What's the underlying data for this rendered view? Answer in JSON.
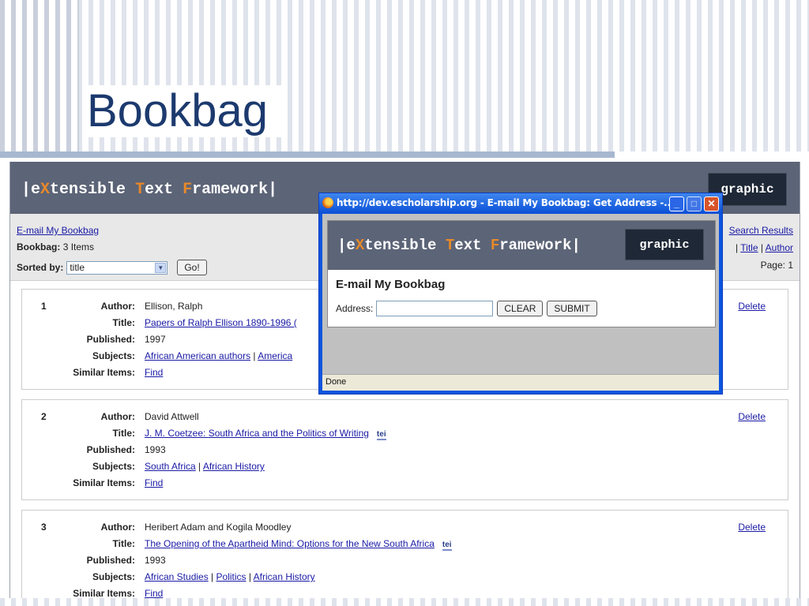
{
  "slide": {
    "title": "Bookbag"
  },
  "xtf": {
    "logo_parts": [
      "|e",
      "X",
      "tensible ",
      "T",
      "ext ",
      "F",
      "ramework|"
    ],
    "graphic_label": "graphic"
  },
  "toolbar": {
    "email_link": "E-mail My Bookbag",
    "bookbag_label": "Bookbag:",
    "bookbag_count": "3 Items",
    "sorted_by_label": "Sorted by:",
    "sort_value": "title",
    "go_label": "Go!",
    "search_results": "Search Results",
    "sort_sep": "|",
    "sort_title": "Title",
    "sort_author": "Author",
    "page_label": "Page: 1"
  },
  "labels": {
    "author": "Author:",
    "title": "Title:",
    "published": "Published:",
    "subjects": "Subjects:",
    "similar": "Similar Items:",
    "delete": "Delete",
    "find": "Find",
    "tei": "tei"
  },
  "items": [
    {
      "num": "1",
      "author": "Ellison, Ralph",
      "title": "Papers of Ralph Ellison 1890-1996 (",
      "published": "1997",
      "subjects": [
        "African American authors",
        "America"
      ]
    },
    {
      "num": "2",
      "author": "David Attwell",
      "title": "J. M. Coetzee: South Africa and the Politics of Writing",
      "published": "1993",
      "subjects": [
        "South Africa",
        "African History"
      ]
    },
    {
      "num": "3",
      "author": "Heribert Adam and Kogila Moodley",
      "title": "The Opening of the Apartheid Mind: Options for the New South Africa",
      "published": "1993",
      "subjects": [
        "African Studies",
        "Politics",
        "African History"
      ]
    }
  ],
  "popup": {
    "window_title": "http://dev.escholarship.org - E-mail My Bookbag: Get Address -...",
    "heading": "E-mail My Bookbag",
    "address_label": "Address:",
    "address_value": "",
    "clear_label": "CLEAR",
    "submit_label": "SUBMIT",
    "status": "Done"
  },
  "colors": {
    "header_bg": "#5c6477",
    "highlight": "#e8892a",
    "link": "#1a1aa6",
    "title_text": "#1c3a6e"
  }
}
